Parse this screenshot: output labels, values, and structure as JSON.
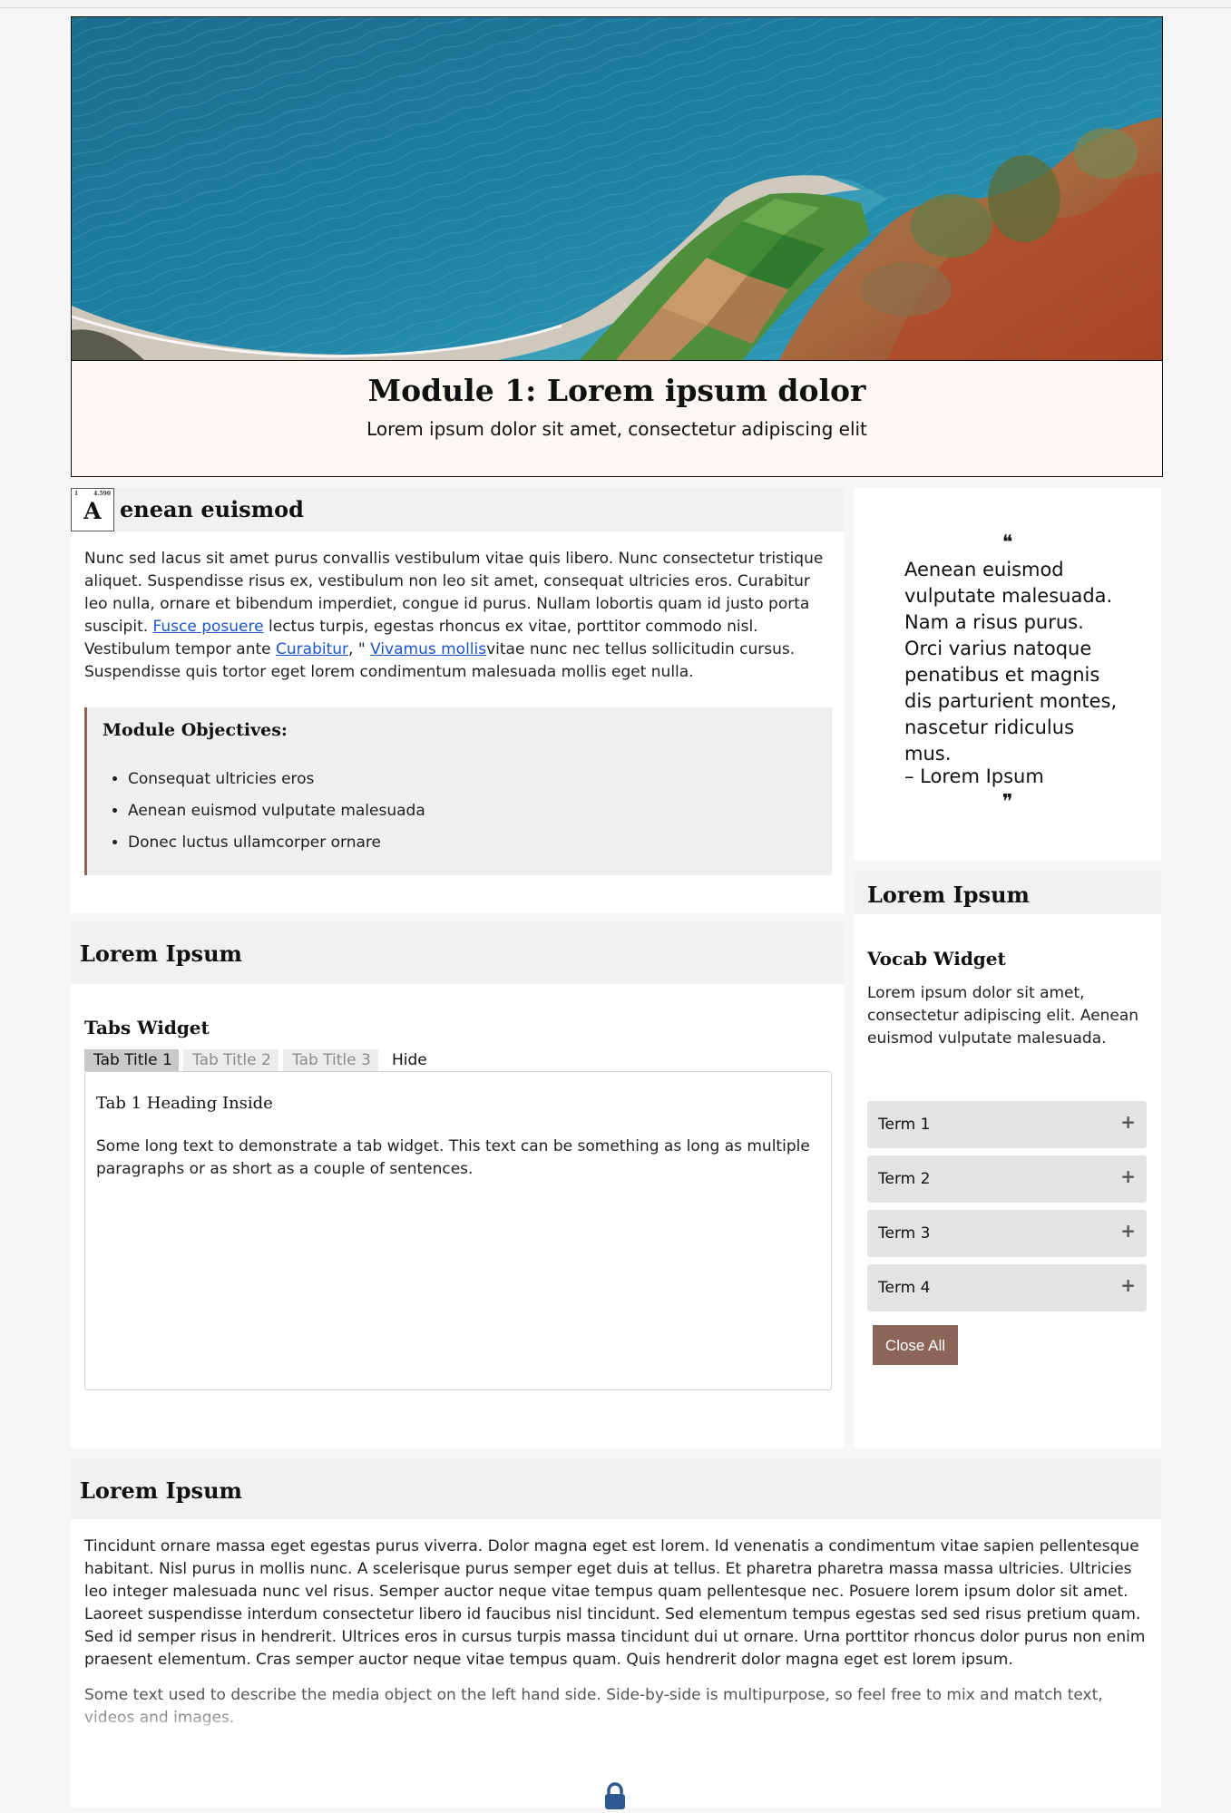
{
  "hero": {
    "title": "Module 1: Lorem ipsum dolor",
    "subtitle": "Lorem ipsum dolor sit amet, consectetur adipiscing elit"
  },
  "intro": {
    "dropcap_letter": "A",
    "dropcap_tag_left": "1",
    "dropcap_tag_right": "4.590",
    "heading_rest": "enean euismod",
    "text1": "Nunc sed lacus sit amet purus convallis vestibulum vitae quis libero. Nunc consectetur tristique aliquet. Suspendisse risus ex, vestibulum non leo sit amet, consequat ultricies eros. Curabitur leo nulla, ornare et bibendum imperdiet, congue id purus. Nullam lobortis quam id justo porta suscipit. ",
    "link1": "Fusce posuere",
    "text2": " lectus turpis, egestas rhoncus ex vitae, porttitor commodo nisl. Vestibulum tempor ante ",
    "link2": "Curabitur",
    "text3": ", \" ",
    "link3": "Vivamus mollis",
    "text4": "vitae nunc nec tellus sollicitudin cursus. Suspendisse quis tortor eget lorem condimentum malesuada mollis eget nulla.",
    "objectives_title": "Module Objectives:",
    "objectives": [
      "Consequat ultricies eros",
      "Aenean euismod vulputate malesuada",
      "Donec luctus ullamcorper ornare"
    ]
  },
  "quote": {
    "open_mark": "❝",
    "text": "Aenean euismod vulputate malesuada. Nam a risus purus. Orci varius natoque penatibus et magnis dis parturient montes, nascetur ridiculus mus.",
    "author": "– Lorem Ipsum",
    "close_mark": "❞"
  },
  "tabs_section": {
    "heading": "Lorem Ipsum",
    "widget_title": "Tabs Widget",
    "tabs": [
      "Tab Title 1",
      "Tab Title 2",
      "Tab Title 3"
    ],
    "hide_label": "Hide",
    "content_heading": "Tab 1 Heading Inside",
    "content_text": "Some long text to demonstrate a tab widget. This text can be something as long as multiple paragraphs or as short as a couple of sentences."
  },
  "vocab_section": {
    "heading": "Lorem Ipsum",
    "widget_title": "Vocab Widget",
    "description": "Lorem ipsum dolor sit amet, consectetur adipiscing elit. Aenean euismod vulputate malesuada.",
    "terms": [
      "Term 1",
      "Term 2",
      "Term 3",
      "Term 4"
    ],
    "expand_icon": "+",
    "close_all_label": "Close All"
  },
  "bottom_section": {
    "heading": "Lorem Ipsum",
    "paragraph": "Tincidunt ornare massa eget egestas purus viverra. Dolor magna eget est lorem. Id venenatis a condimentum vitae sapien pellentesque habitant. Nisl purus in mollis nunc. A scelerisque purus semper eget duis at tellus. Et pharetra pharetra massa massa ultricies. Ultricies leo integer malesuada nunc vel risus. Semper auctor neque vitae tempus quam pellentesque nec. Posuere lorem ipsum dolor sit amet. Laoreet suspendisse interdum consectetur libero id faucibus nisl tincidunt. Sed elementum tempus egestas sed sed risus pretium quam. Sed id semper risus in hendrerit. Ultrices eros in cursus turpis massa tincidunt dui ut ornare. Urna porttitor rhoncus dolor purus non enim praesent elementum. Cras semper auctor neque vitae tempus quam. Quis hendrerit dolor magna eget est lorem ipsum.",
    "caption": "Some text used to describe the media object on the left hand side. Side-by-side is multipurpose, so feel free to mix and match text, videos and images.",
    "icon": "lock-icon"
  },
  "colors": {
    "accent_brown": "#8a6558",
    "link_blue": "#1a56c9",
    "header_bg": "#f3f1f0",
    "hero_caption_bg": "#fbf7f2"
  }
}
